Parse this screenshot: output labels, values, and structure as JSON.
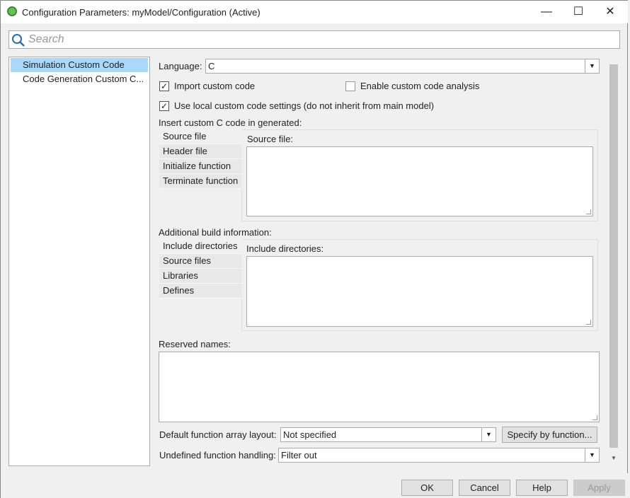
{
  "window": {
    "title": "Configuration Parameters: myModel/Configuration (Active)",
    "minimize": "—",
    "maximize": "☐",
    "close": "✕"
  },
  "search": {
    "placeholder": "Search"
  },
  "tree": {
    "items": [
      {
        "label": "Simulation Custom Code",
        "selected": true
      },
      {
        "label": "Code Generation Custom C..."
      }
    ]
  },
  "language": {
    "label": "Language:",
    "value": "C"
  },
  "import_custom_code": {
    "label": "Import custom code",
    "checked": true
  },
  "enable_analysis": {
    "label": "Enable custom code analysis",
    "checked": false
  },
  "use_local": {
    "label": "Use local custom code settings (do not inherit from main model)",
    "checked": true
  },
  "insert_section": {
    "label": "Insert custom C code in generated:",
    "tabs": [
      "Source file",
      "Header file",
      "Initialize function",
      "Terminate function"
    ],
    "panel_label": "Source file:",
    "value": ""
  },
  "build_section": {
    "label": "Additional build information:",
    "tabs": [
      "Include directories",
      "Source files",
      "Libraries",
      "Defines"
    ],
    "panel_label": "Include directories:",
    "value": ""
  },
  "reserved": {
    "label": "Reserved names:",
    "value": ""
  },
  "array_layout": {
    "label": "Default function array layout:",
    "value": "Not specified",
    "button": "Specify by function..."
  },
  "undefined_handling": {
    "label": "Undefined function handling:",
    "value": "Filter out"
  },
  "footer": {
    "ok": "OK",
    "cancel": "Cancel",
    "help": "Help",
    "apply": "Apply"
  }
}
